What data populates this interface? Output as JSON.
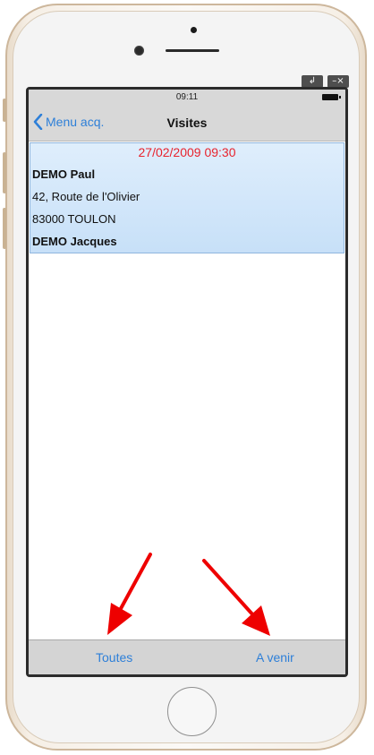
{
  "window_controls": {
    "restore": "↲",
    "minimize_close": "–×"
  },
  "status": {
    "time": "09:11"
  },
  "nav": {
    "back_label": "Menu acq.",
    "title": "Visites"
  },
  "visits": [
    {
      "datetime": "27/02/2009 09:30",
      "name": "DEMO Paul",
      "address": "42, Route de l'Olivier",
      "city": "83000 TOULON",
      "contact": "DEMO Jacques"
    }
  ],
  "tabs": {
    "all": "Toutes",
    "upcoming": "A venir"
  },
  "colors": {
    "accent": "#2d7fd8",
    "date": "#e8232d",
    "arrow": "#ee0000"
  },
  "annotation": {
    "arrows": [
      "points to Toutes",
      "points to A venir"
    ]
  }
}
